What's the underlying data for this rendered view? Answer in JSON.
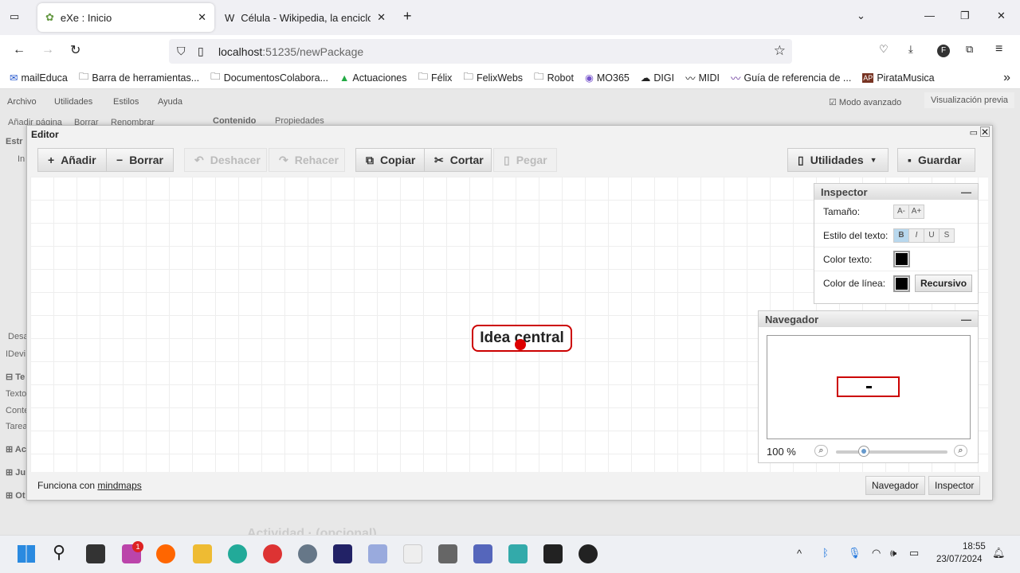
{
  "browser": {
    "tabs": [
      {
        "label": "eXe : Inicio"
      },
      {
        "label": "Célula - Wikipedia, la enciclope"
      }
    ],
    "url_host": "localhost",
    "url_rest": ":51235/newPackage",
    "bookmarks": [
      "mailEduca",
      "Barra de herramientas...",
      "DocumentosColabora...",
      "Actuaciones",
      "Félix",
      "FelixWebs",
      "Robot",
      "MO365",
      "DIGI",
      "MIDI",
      "Guía de referencia de ...",
      "PirataMusica"
    ],
    "profile_initial": "F"
  },
  "app": {
    "menu": [
      "Archivo",
      "Utilidades",
      "Estilos",
      "Ayuda"
    ],
    "advanced_mode": "Modo avanzado",
    "preview": "Visualización previa",
    "bg_toolbar": [
      "Añadir página",
      "Borrar",
      "Renombrar"
    ],
    "bg_tabs": [
      "Contenido",
      "Propiedades"
    ],
    "left_fragments": [
      "Estr",
      "In",
      "Desa",
      "IDevi",
      "Te",
      "Texto",
      "Conte",
      "Tarea",
      "Ac",
      "Ju",
      "Ot"
    ],
    "bg_heading": "Actividad · (opcional)"
  },
  "editor": {
    "title": "Editor",
    "toolbar": {
      "add": "Añadir",
      "delete": "Borrar",
      "undo": "Deshacer",
      "redo": "Rehacer",
      "copy": "Copiar",
      "cut": "Cortar",
      "paste": "Pegar",
      "utilities": "Utilidades",
      "save": "Guardar"
    },
    "node": "Idea central",
    "inspector": {
      "title": "Inspector",
      "size_label": "Tamaño:",
      "size_down": "A-",
      "size_up": "A+",
      "style_label": "Estilo del texto:",
      "bold": "B",
      "italic": "I",
      "underline": "U",
      "strike": "S",
      "text_color_label": "Color texto:",
      "line_color_label": "Color de línea:",
      "recursive": "Recursivo",
      "text_color": "#000000",
      "line_color": "#000000"
    },
    "navigator": {
      "title": "Navegador",
      "zoom": "100 %",
      "zoom_fraction": 0.25
    },
    "footer": {
      "prefix": "Funciona con",
      "link": "mindmaps",
      "nav_btn": "Navegador",
      "insp_btn": "Inspector"
    }
  },
  "taskbar": {
    "time": "18:55",
    "date": "23/07/2024",
    "badge": "1"
  }
}
